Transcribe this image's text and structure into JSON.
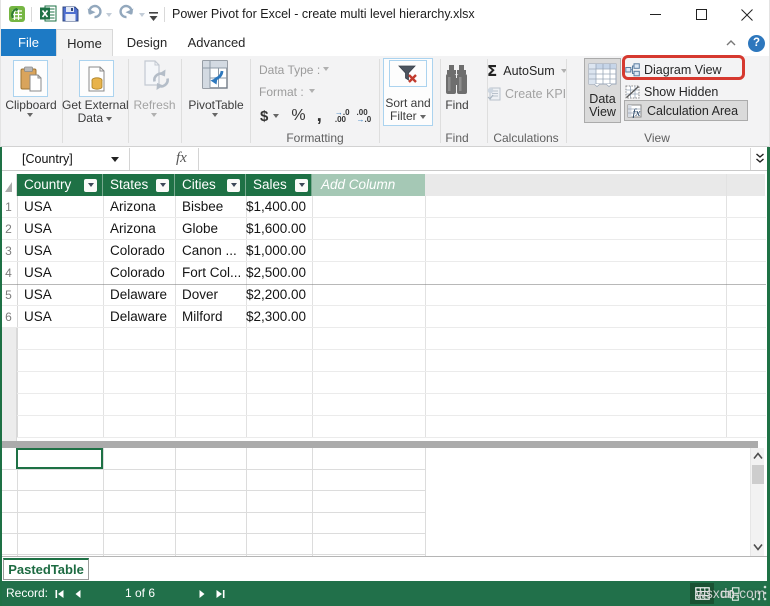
{
  "window": {
    "title": "Power Pivot for Excel - create multi level hierarchy.xlsx"
  },
  "tabs": {
    "file": "File",
    "home": "Home",
    "design": "Design",
    "advanced": "Advanced"
  },
  "help": {
    "question": "?"
  },
  "ribbon": {
    "clipboard": {
      "label": "Clipboard"
    },
    "get_external_data": {
      "line1": "Get External",
      "line2": "Data"
    },
    "refresh": {
      "label": "Refresh"
    },
    "pivottable": {
      "label": "PivotTable"
    },
    "formatting": {
      "data_type_label": "Data Type :",
      "format_label": "Format :",
      "currency": "$",
      "percent": "%",
      "thousands": ",",
      "inc_top": ".0",
      "inc_bottom": ".00",
      "dec_top": ".00",
      "dec_bottom": ".0",
      "group_label": "Formatting"
    },
    "sort_filter": {
      "line1": "Sort and",
      "line2": "Filter"
    },
    "find": {
      "label": "Find",
      "group_label": "Find"
    },
    "calculations": {
      "autosum": "AutoSum",
      "sigma": "Σ",
      "create_kpi": "Create KPI",
      "group_label": "Calculations"
    },
    "view": {
      "data_view_line1": "Data",
      "data_view_line2": "View",
      "diagram_view": "Diagram View",
      "show_hidden": "Show Hidden",
      "calculation_area": "Calculation Area",
      "group_label": "View"
    }
  },
  "formula_bar": {
    "name_box": "[Country]",
    "fx": "fx",
    "formula": ""
  },
  "table": {
    "columns": [
      {
        "label": "Country"
      },
      {
        "label": "States"
      },
      {
        "label": "Cities"
      },
      {
        "label": "Sales"
      }
    ],
    "add_column_label": "Add Column",
    "rows": [
      {
        "num": "1",
        "country": "USA",
        "state": "Arizona",
        "city": "Bisbee",
        "sales": "$1,400.00"
      },
      {
        "num": "2",
        "country": "USA",
        "state": "Arizona",
        "city": "Globe",
        "sales": "$1,600.00"
      },
      {
        "num": "3",
        "country": "USA",
        "state": "Colorado",
        "city": "Canon ...",
        "sales": "$1,000.00"
      },
      {
        "num": "4",
        "country": "USA",
        "state": "Colorado",
        "city": "Fort Col...",
        "sales": "$2,500.00"
      },
      {
        "num": "5",
        "country": "USA",
        "state": "Delaware",
        "city": "Dover",
        "sales": "$2,200.00"
      },
      {
        "num": "6",
        "country": "USA",
        "state": "Delaware",
        "city": "Milford",
        "sales": "$2,300.00"
      }
    ]
  },
  "sheet_tab": "PastedTable",
  "status_bar": {
    "record_label": "Record:",
    "record_position": "1 of 6"
  },
  "watermark": "wsxdn.com",
  "colors": {
    "header_green": "#1e7145",
    "status_green": "#21704a",
    "add_column_green": "#a5c8b5",
    "file_tab_blue": "#1d7ac5",
    "annotation_red": "#d6392f",
    "help_blue": "#2d77bd"
  }
}
